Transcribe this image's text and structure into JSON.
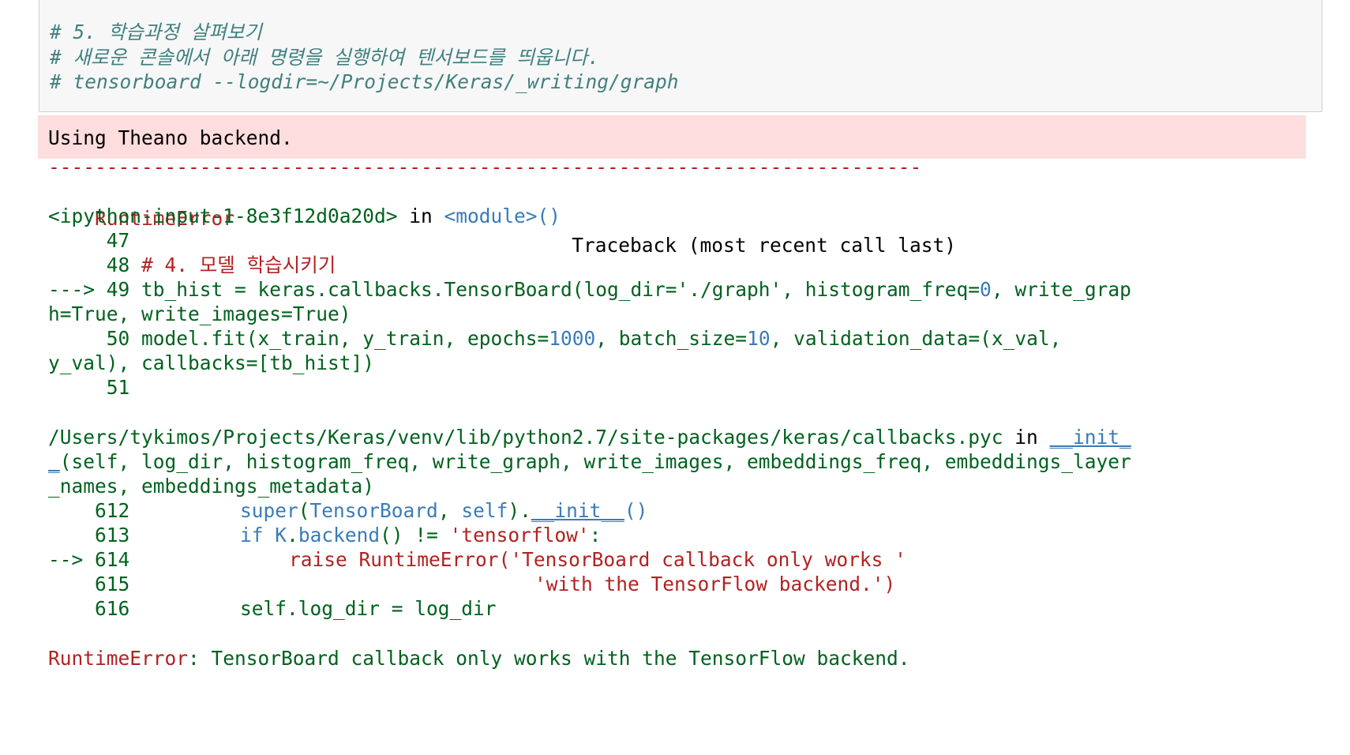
{
  "input": {
    "comment1": "# 5. 학습과정 살펴보기",
    "comment2": "# 새로운 콘솔에서 아래 명령을 실행하여 텐서보드를 띄웁니다.",
    "comment3": "# tensorboard --logdir=~/Projects/Keras/_writing/graph"
  },
  "stderr": {
    "text": "Using Theano backend."
  },
  "traceback": {
    "separator": "---------------------------------------------------------------------------",
    "error_name": "RuntimeError",
    "header_right": "Traceback (most recent call last)",
    "frame1": {
      "source": "<ipython-input-1-8e3f12d0a20d>",
      "in_word": " in ",
      "func": "<module>",
      "parens": "()",
      "line47": "     47",
      "line48_num": "     48 ",
      "line48_code": "# 4. 모델 학습시키기",
      "arrow49": "---> 49 ",
      "line49_a": "tb_hist = keras.callbacks.TensorBoard(log_dir='./graph', histogram_freq=",
      "line49_zero": "0",
      "line49_b": ", write_grap",
      "line49_cont": "h=True, write_images=True)",
      "line50_num": "     50 ",
      "line50_a": "model.fit(x_train, y_train, epochs=",
      "line50_epochs": "1000",
      "line50_b": ", batch_size=",
      "line50_batch": "10",
      "line50_c": ", validation_data=(x_val,",
      "line50_cont": "y_val), callbacks=[tb_hist])",
      "line51": "     51"
    },
    "frame2": {
      "path": "/Users/tykimos/Projects/Keras/venv/lib/python2.7/site-packages/keras/callbacks.pyc",
      "in_word": " in ",
      "func1": "__init_",
      "func2": "_",
      "sig1": "(self, log_dir, histogram_freq, write_graph, write_images, embeddings_freq, embeddings_layer",
      "sig2": "_names, embeddings_metadata)",
      "l612_num": "    612 ",
      "l612_super": "super",
      "l612_a": "(",
      "l612_cls": "TensorBoard",
      "l612_b": ", ",
      "l612_self": "self",
      "l612_c": ").",
      "l612_init": "__init__",
      "l612_d": "()",
      "l613_num": "    613 ",
      "l613_if": "if",
      "l613_K": "K",
      "l613_dot": ".",
      "l613_backend": "backend",
      "l613_a": "() != ",
      "l613_str": "'tensorflow'",
      "l613_colon": ":",
      "l614_arrow": "--> 614 ",
      "l614_raise": "raise",
      "l614_err": "RuntimeError",
      "l614_a": "(",
      "l614_str": "'TensorBoard callback only works '",
      "l615_num": "    615 ",
      "l615_str": "'with the TensorFlow backend.'",
      "l615_close": ")",
      "l616_num": "    616 ",
      "l616_code": "self.log_dir = log_dir"
    },
    "final_name": "RuntimeError",
    "final_msg": ": TensorBoard callback only works with the TensorFlow backend."
  }
}
